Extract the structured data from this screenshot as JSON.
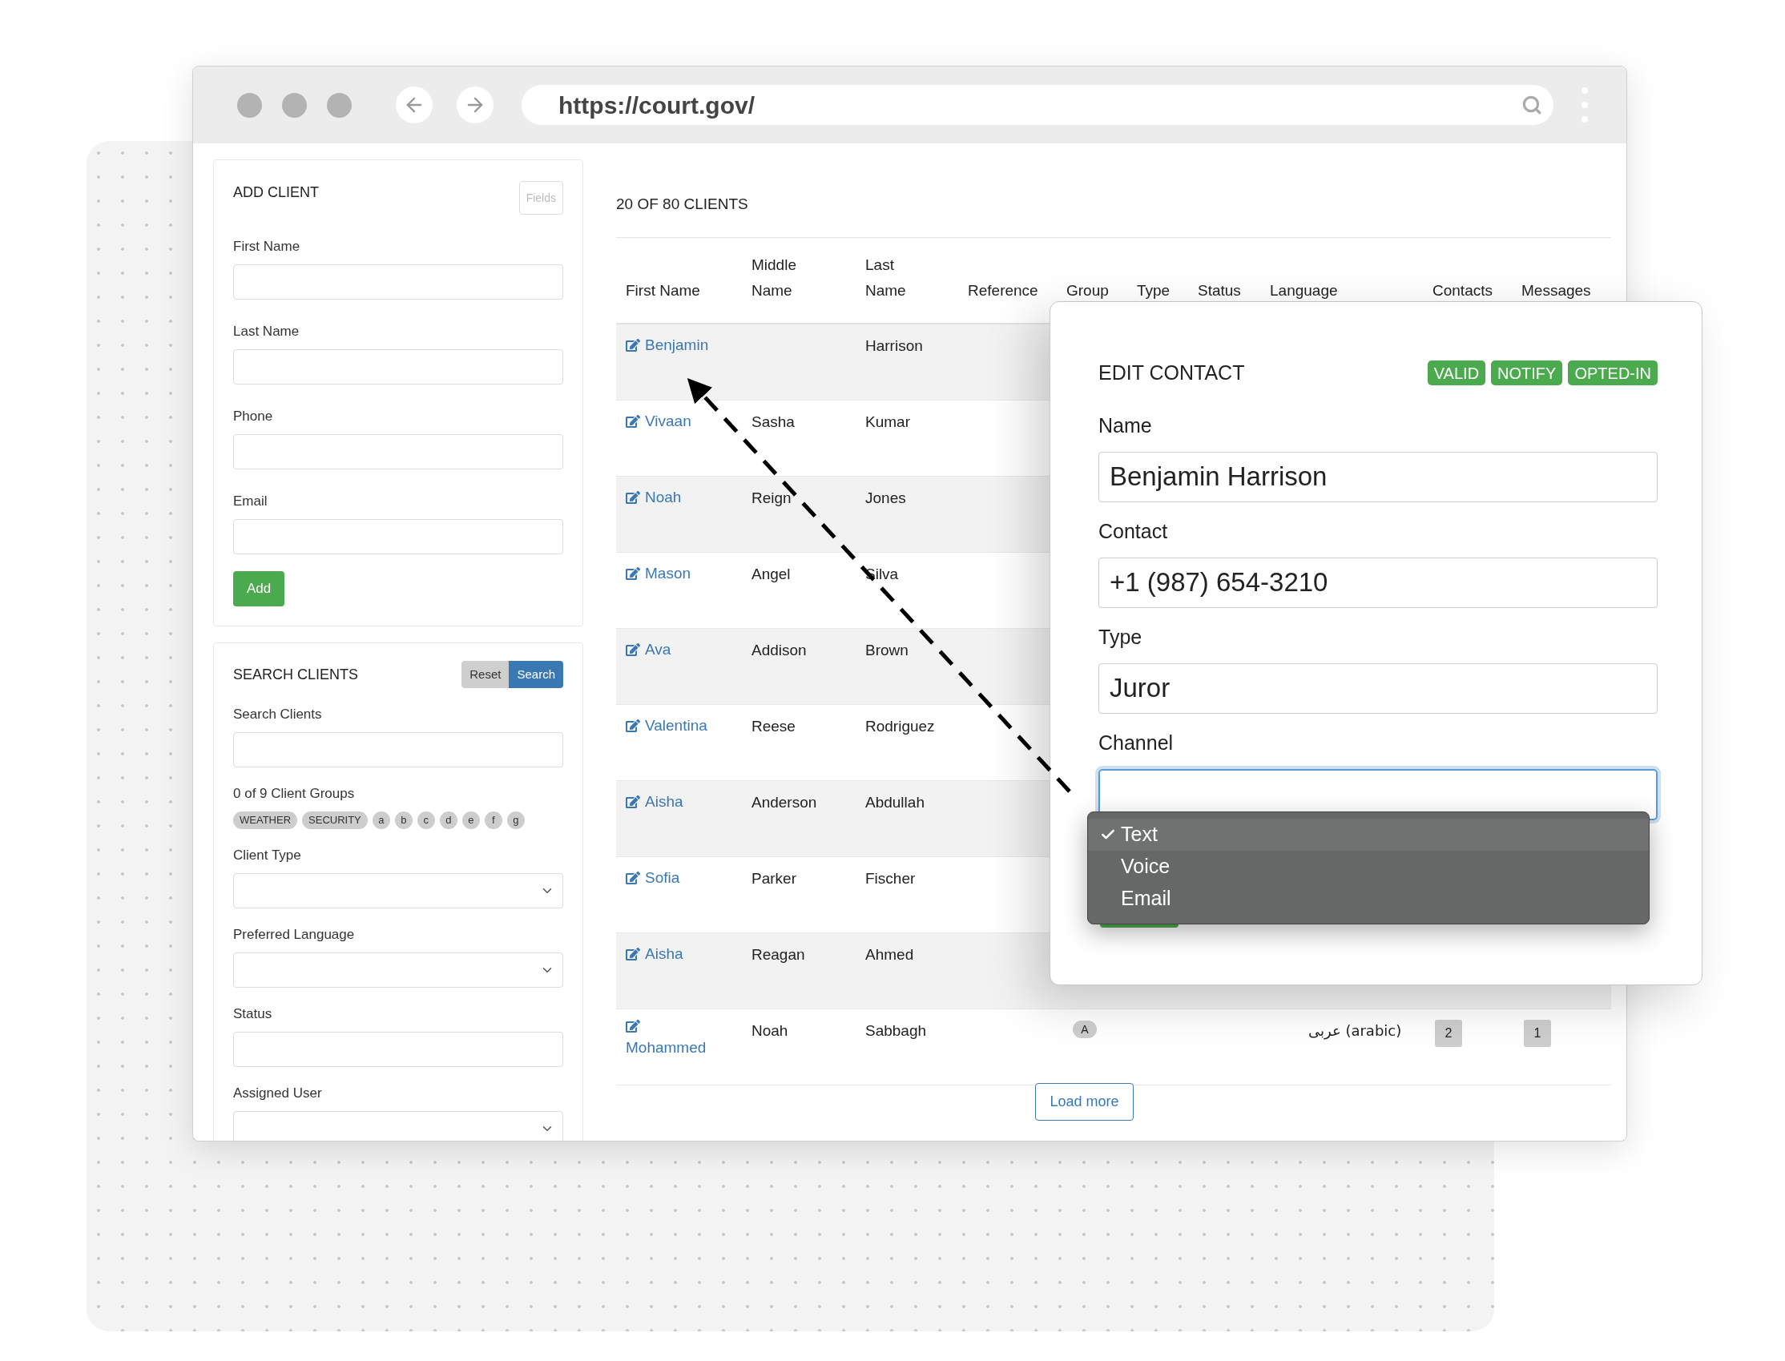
{
  "browser": {
    "url": "https://court.gov/"
  },
  "add_client": {
    "title": "ADD CLIENT",
    "fields_button": "Fields",
    "fields": [
      {
        "label": "First Name"
      },
      {
        "label": "Last Name"
      },
      {
        "label": "Phone"
      },
      {
        "label": "Email"
      }
    ],
    "add_button": "Add"
  },
  "search_clients": {
    "title": "SEARCH CLIENTS",
    "reset_button": "Reset",
    "search_button": "Search",
    "items": [
      {
        "kind": "input",
        "label": "Search Clients"
      },
      {
        "kind": "chips",
        "label": "0 of 9 Client Groups",
        "chips": [
          "WEATHER",
          "SECURITY",
          "a",
          "b",
          "c",
          "d",
          "e",
          "f",
          "g"
        ]
      },
      {
        "kind": "select",
        "label": "Client Type"
      },
      {
        "kind": "select",
        "label": "Preferred Language"
      },
      {
        "kind": "input",
        "label": "Status"
      },
      {
        "kind": "select",
        "label": "Assigned User"
      }
    ]
  },
  "clients": {
    "count": "20 OF 80 CLIENTS",
    "columns": [
      "First Name",
      "Middle Name",
      "Last Name",
      "Reference",
      "Group",
      "Type",
      "Status",
      "Language",
      "Contacts",
      "Messages"
    ],
    "rows": [
      {
        "first": "Benjamin",
        "last": "Harrison"
      },
      {
        "first": "Vivaan",
        "middle": "Sasha",
        "last": "Kumar"
      },
      {
        "first": "Noah",
        "middle": "Reign",
        "last": "Jones"
      },
      {
        "first": "Mason",
        "middle": "Angel",
        "last": "Silva"
      },
      {
        "first": "Ava",
        "middle": "Addison",
        "last": "Brown"
      },
      {
        "first": "Valentina",
        "middle": "Reese",
        "last": "Rodriguez"
      },
      {
        "first": "Aisha",
        "middle": "Anderson",
        "last": "Abdullah"
      },
      {
        "first": "Sofia",
        "middle": "Parker",
        "last": "Fischer"
      },
      {
        "first": "Aisha",
        "middle": "Reagan",
        "last": "Ahmed"
      },
      {
        "first": "Mohammed",
        "middle": "Noah",
        "last": "Sabbagh",
        "group": "A",
        "language": "عربى (arabic)",
        "contacts": "2",
        "messages": "1"
      }
    ],
    "load_more": "Load more"
  },
  "edit_contact": {
    "title": "EDIT CONTACT",
    "badges": [
      "VALID",
      "NOTIFY",
      "OPTED-IN"
    ],
    "fields": [
      {
        "label": "Name",
        "value": "Benjamin Harrison"
      },
      {
        "label": "Contact",
        "value": "+1 (987) 654-3210"
      },
      {
        "label": "Type",
        "value": "Juror"
      }
    ],
    "channel": {
      "label": "Channel",
      "options": [
        {
          "label": "Text",
          "selected": true
        },
        {
          "label": "Voice",
          "selected": false
        },
        {
          "label": "Email",
          "selected": false
        }
      ]
    }
  }
}
